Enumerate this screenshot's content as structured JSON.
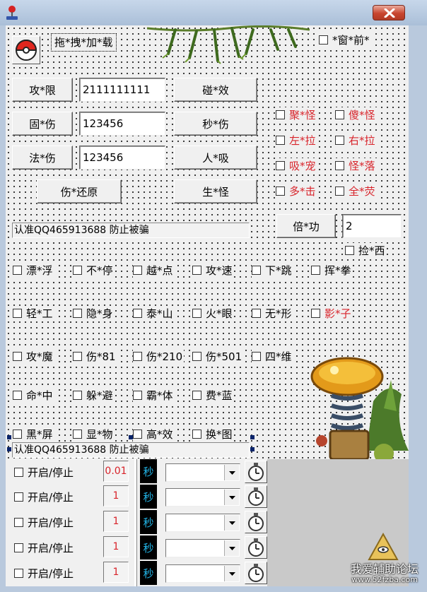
{
  "window": {
    "close_icon": "close-icon",
    "app_icon": "joystick-icon"
  },
  "header": {
    "drag_load": "拖*拽*加*载",
    "topmost": "*窗*前*"
  },
  "rows": {
    "attack_limit": {
      "button": "攻*限",
      "value": "2111111111",
      "right_button": "碰*效"
    },
    "fixed_damage": {
      "button": "固*伤",
      "value": "123456",
      "right_button": "秒*伤"
    },
    "magic_damage": {
      "button": "法*伤",
      "value": "123456",
      "right_button": "人*吸"
    },
    "restore": {
      "button": "伤*还原",
      "right_button": "生*怪"
    }
  },
  "red_options": [
    "聚*怪",
    "傻*怪",
    "左*拉",
    "右*拉",
    "吸*宠",
    "怪*落",
    "多*击",
    "全*荧"
  ],
  "notice": "认准QQ465913688   防止被骗",
  "multiplier": {
    "button": "倍*功",
    "value": "2",
    "pickup": "捡*西"
  },
  "feature_rows": [
    [
      "漂*浮",
      "不*停",
      "越*点",
      "攻*速",
      "下*跳",
      "挥*拳"
    ],
    [
      "轻*工",
      "隐*身",
      "泰*山",
      "火*眼",
      "无*形",
      "影*子"
    ],
    [
      "攻*魔",
      "伤*81",
      "伤*210",
      "伤*501",
      "四*维"
    ],
    [
      "命*中",
      "躲*避",
      "霸*体",
      "费*蓝"
    ],
    [
      "黑*屏",
      "显*物",
      "高*效",
      "换*图"
    ]
  ],
  "notice2": "认准QQ465913688   防止被骗",
  "timers": [
    {
      "label": "开启/停止",
      "value": "0.01",
      "unit": "秒"
    },
    {
      "label": "开启/停止",
      "value": "1",
      "unit": "秒"
    },
    {
      "label": "开启/停止",
      "value": "1",
      "unit": "秒"
    },
    {
      "label": "开启/停止",
      "value": "1",
      "unit": "秒"
    },
    {
      "label": "开启/停止",
      "value": "1",
      "unit": "秒"
    }
  ],
  "watermark": {
    "title": "我爱辅助论坛",
    "url": "www.52fzba.com"
  },
  "colors": {
    "accent_red": "#d8232a",
    "unit_blue": "#22b5e8"
  }
}
